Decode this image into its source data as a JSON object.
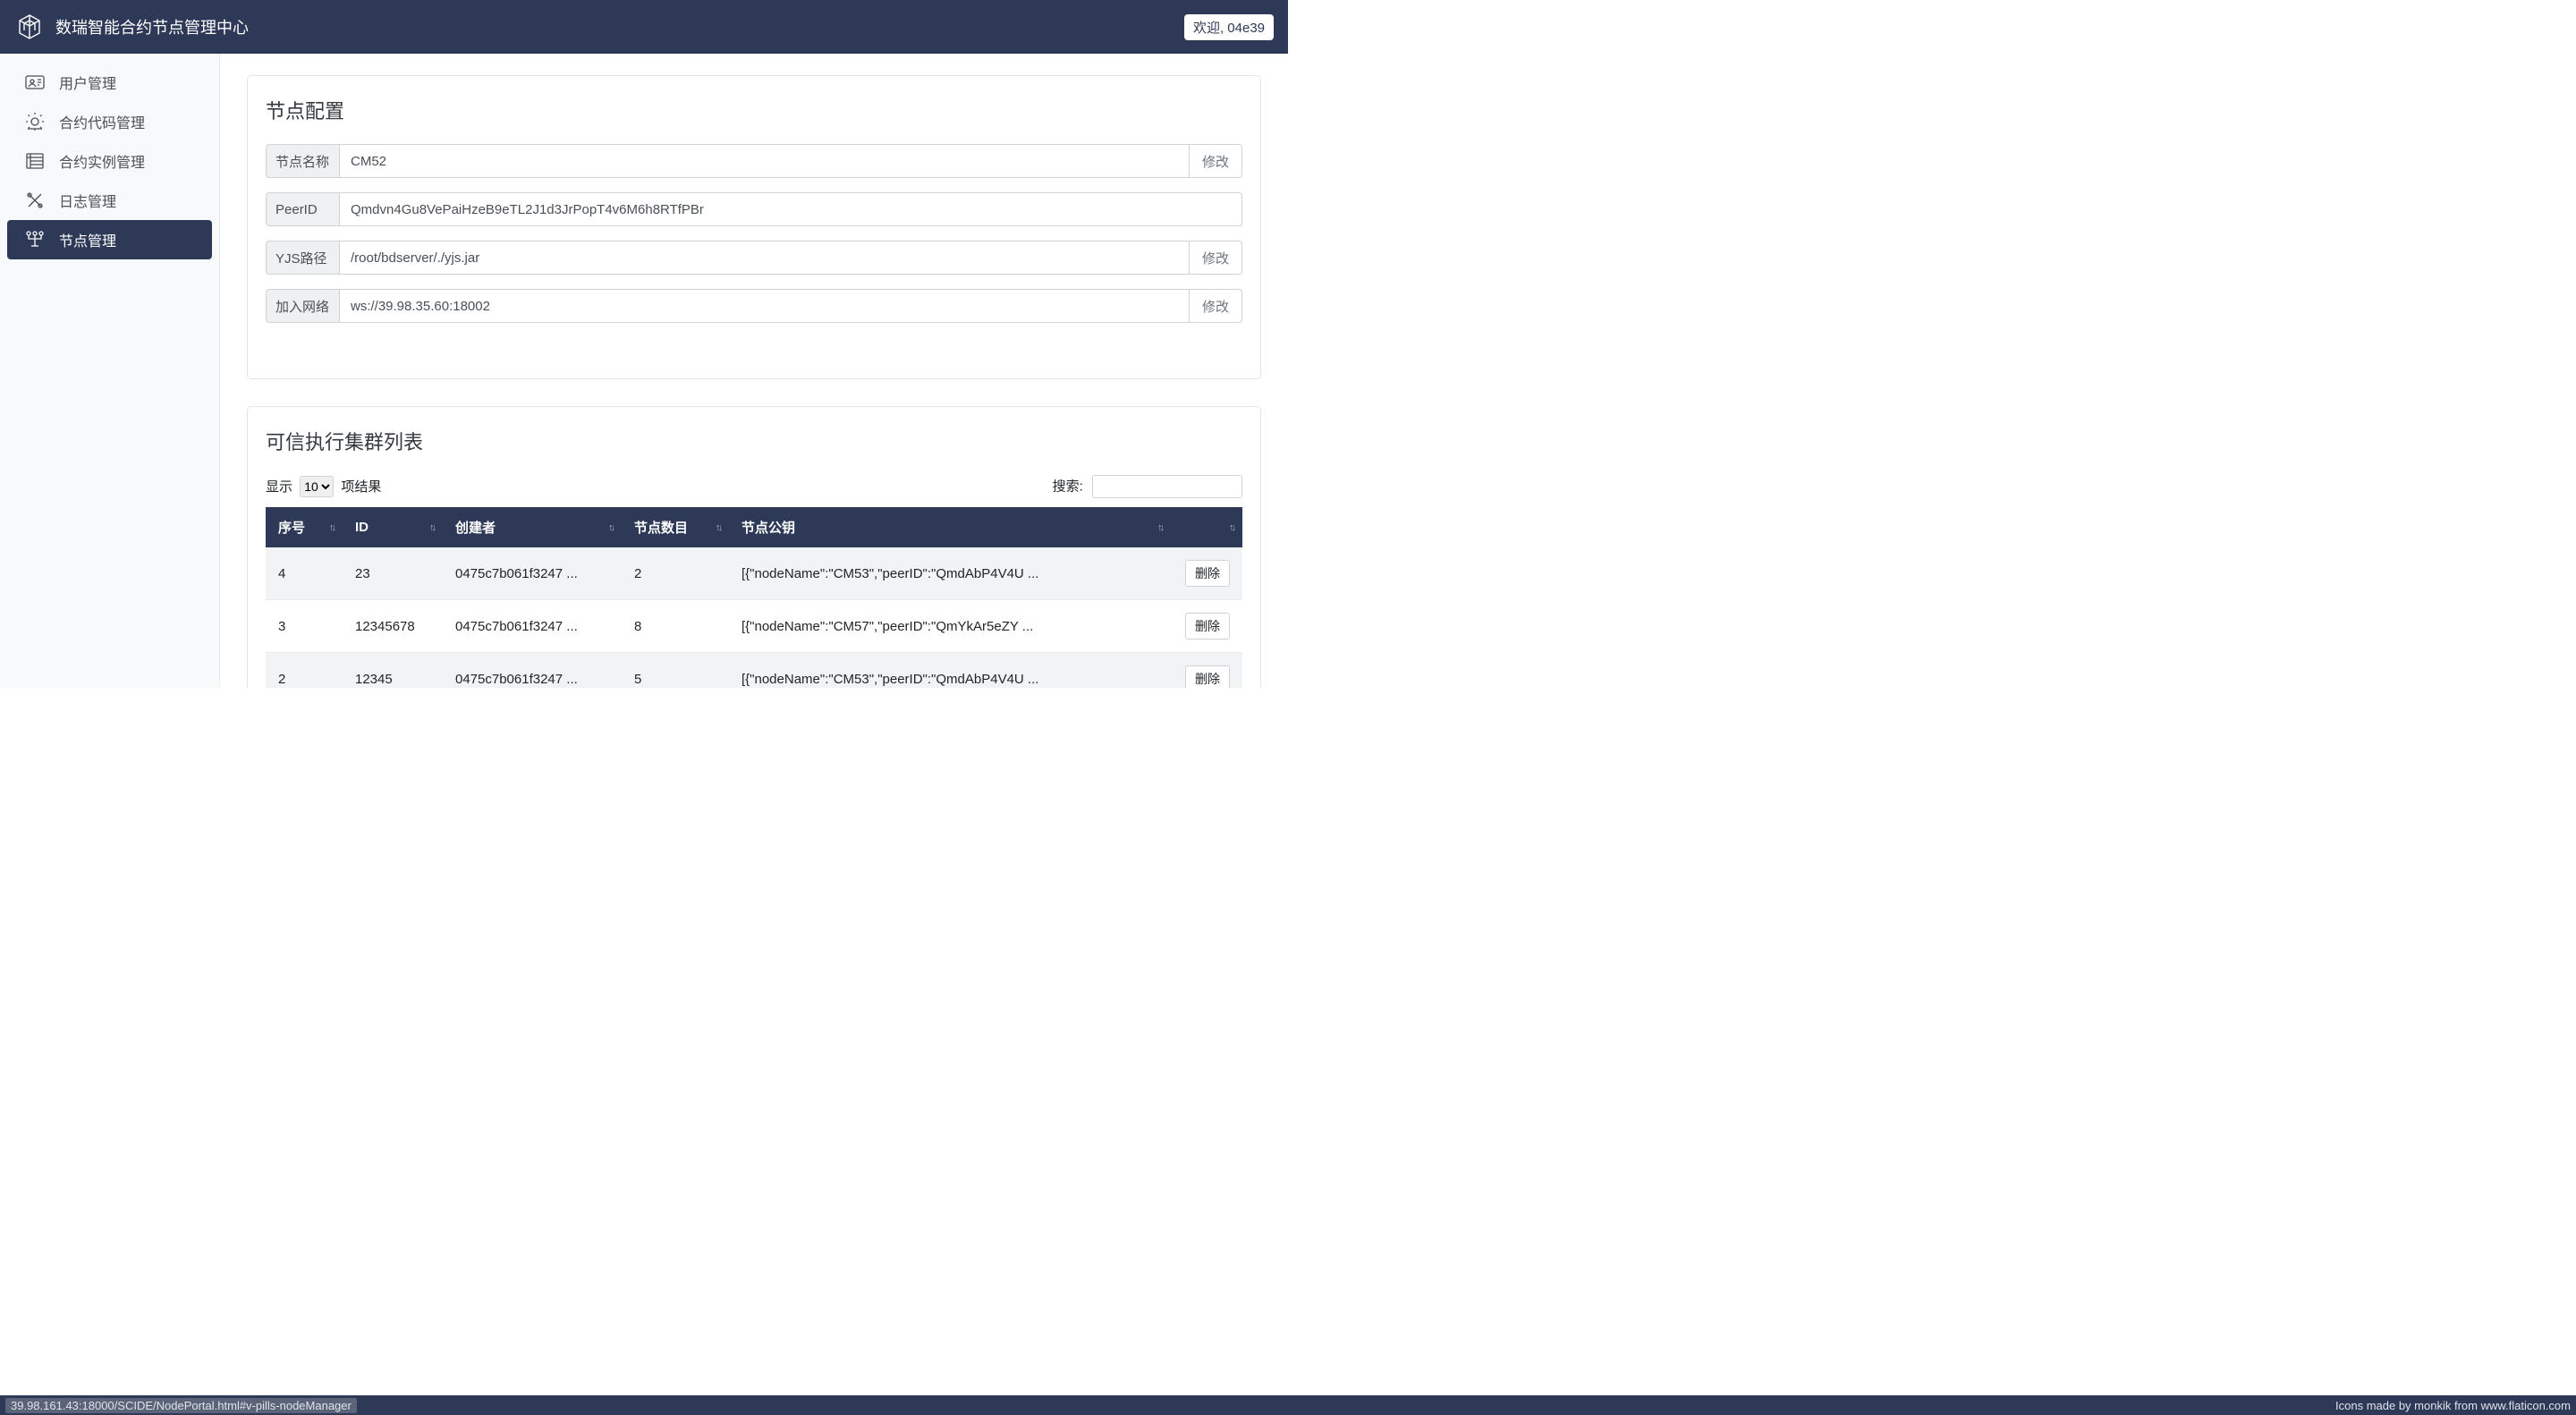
{
  "header": {
    "title": "数瑞智能合约节点管理中心",
    "welcome": "欢迎, 04e39"
  },
  "sidebar": {
    "items": [
      {
        "label": "用户管理"
      },
      {
        "label": "合约代码管理"
      },
      {
        "label": "合约实例管理"
      },
      {
        "label": "日志管理"
      },
      {
        "label": "节点管理"
      }
    ]
  },
  "config": {
    "title": "节点配置",
    "rows": {
      "nodeName": {
        "label": "节点名称",
        "value": "CM52",
        "btn": "修改"
      },
      "peerId": {
        "label": "PeerID",
        "value": "Qmdvn4Gu8VePaiHzeB9eTL2J1d3JrPopT4v6M6h8RTfPBr"
      },
      "yjs": {
        "label": "YJS路径",
        "value": "/root/bdserver/./yjs.jar",
        "btn": "修改"
      },
      "network": {
        "label": "加入网络",
        "value": "ws://39.98.35.60:18002",
        "btn": "修改"
      }
    }
  },
  "cluster": {
    "title": "可信执行集群列表",
    "show_prefix": "显示",
    "show_suffix": "项结果",
    "page_size": "10",
    "search_label": "搜索:",
    "headers": [
      "序号",
      "ID",
      "创建者",
      "节点数目",
      "节点公钥",
      ""
    ],
    "rows": [
      {
        "seq": "4",
        "id": "23",
        "creator": "0475c7b061f3247 ...",
        "count": "2",
        "pubkey": "[{\"nodeName\":\"CM53\",\"peerID\":\"QmdAbP4V4U ...",
        "btn": "删除"
      },
      {
        "seq": "3",
        "id": "12345678",
        "creator": "0475c7b061f3247 ...",
        "count": "8",
        "pubkey": "[{\"nodeName\":\"CM57\",\"peerID\":\"QmYkAr5eZY ...",
        "btn": "删除"
      },
      {
        "seq": "2",
        "id": "12345",
        "creator": "0475c7b061f3247 ...",
        "count": "5",
        "pubkey": "[{\"nodeName\":\"CM53\",\"peerID\":\"QmdAbP4V4U ...",
        "btn": "删除"
      }
    ]
  },
  "footer": {
    "url": "39.98.161.43:18000/SCIDE/NodePortal.html#v-pills-nodeManager",
    "credits": "Icons made by monkik from www.flaticon.com"
  }
}
